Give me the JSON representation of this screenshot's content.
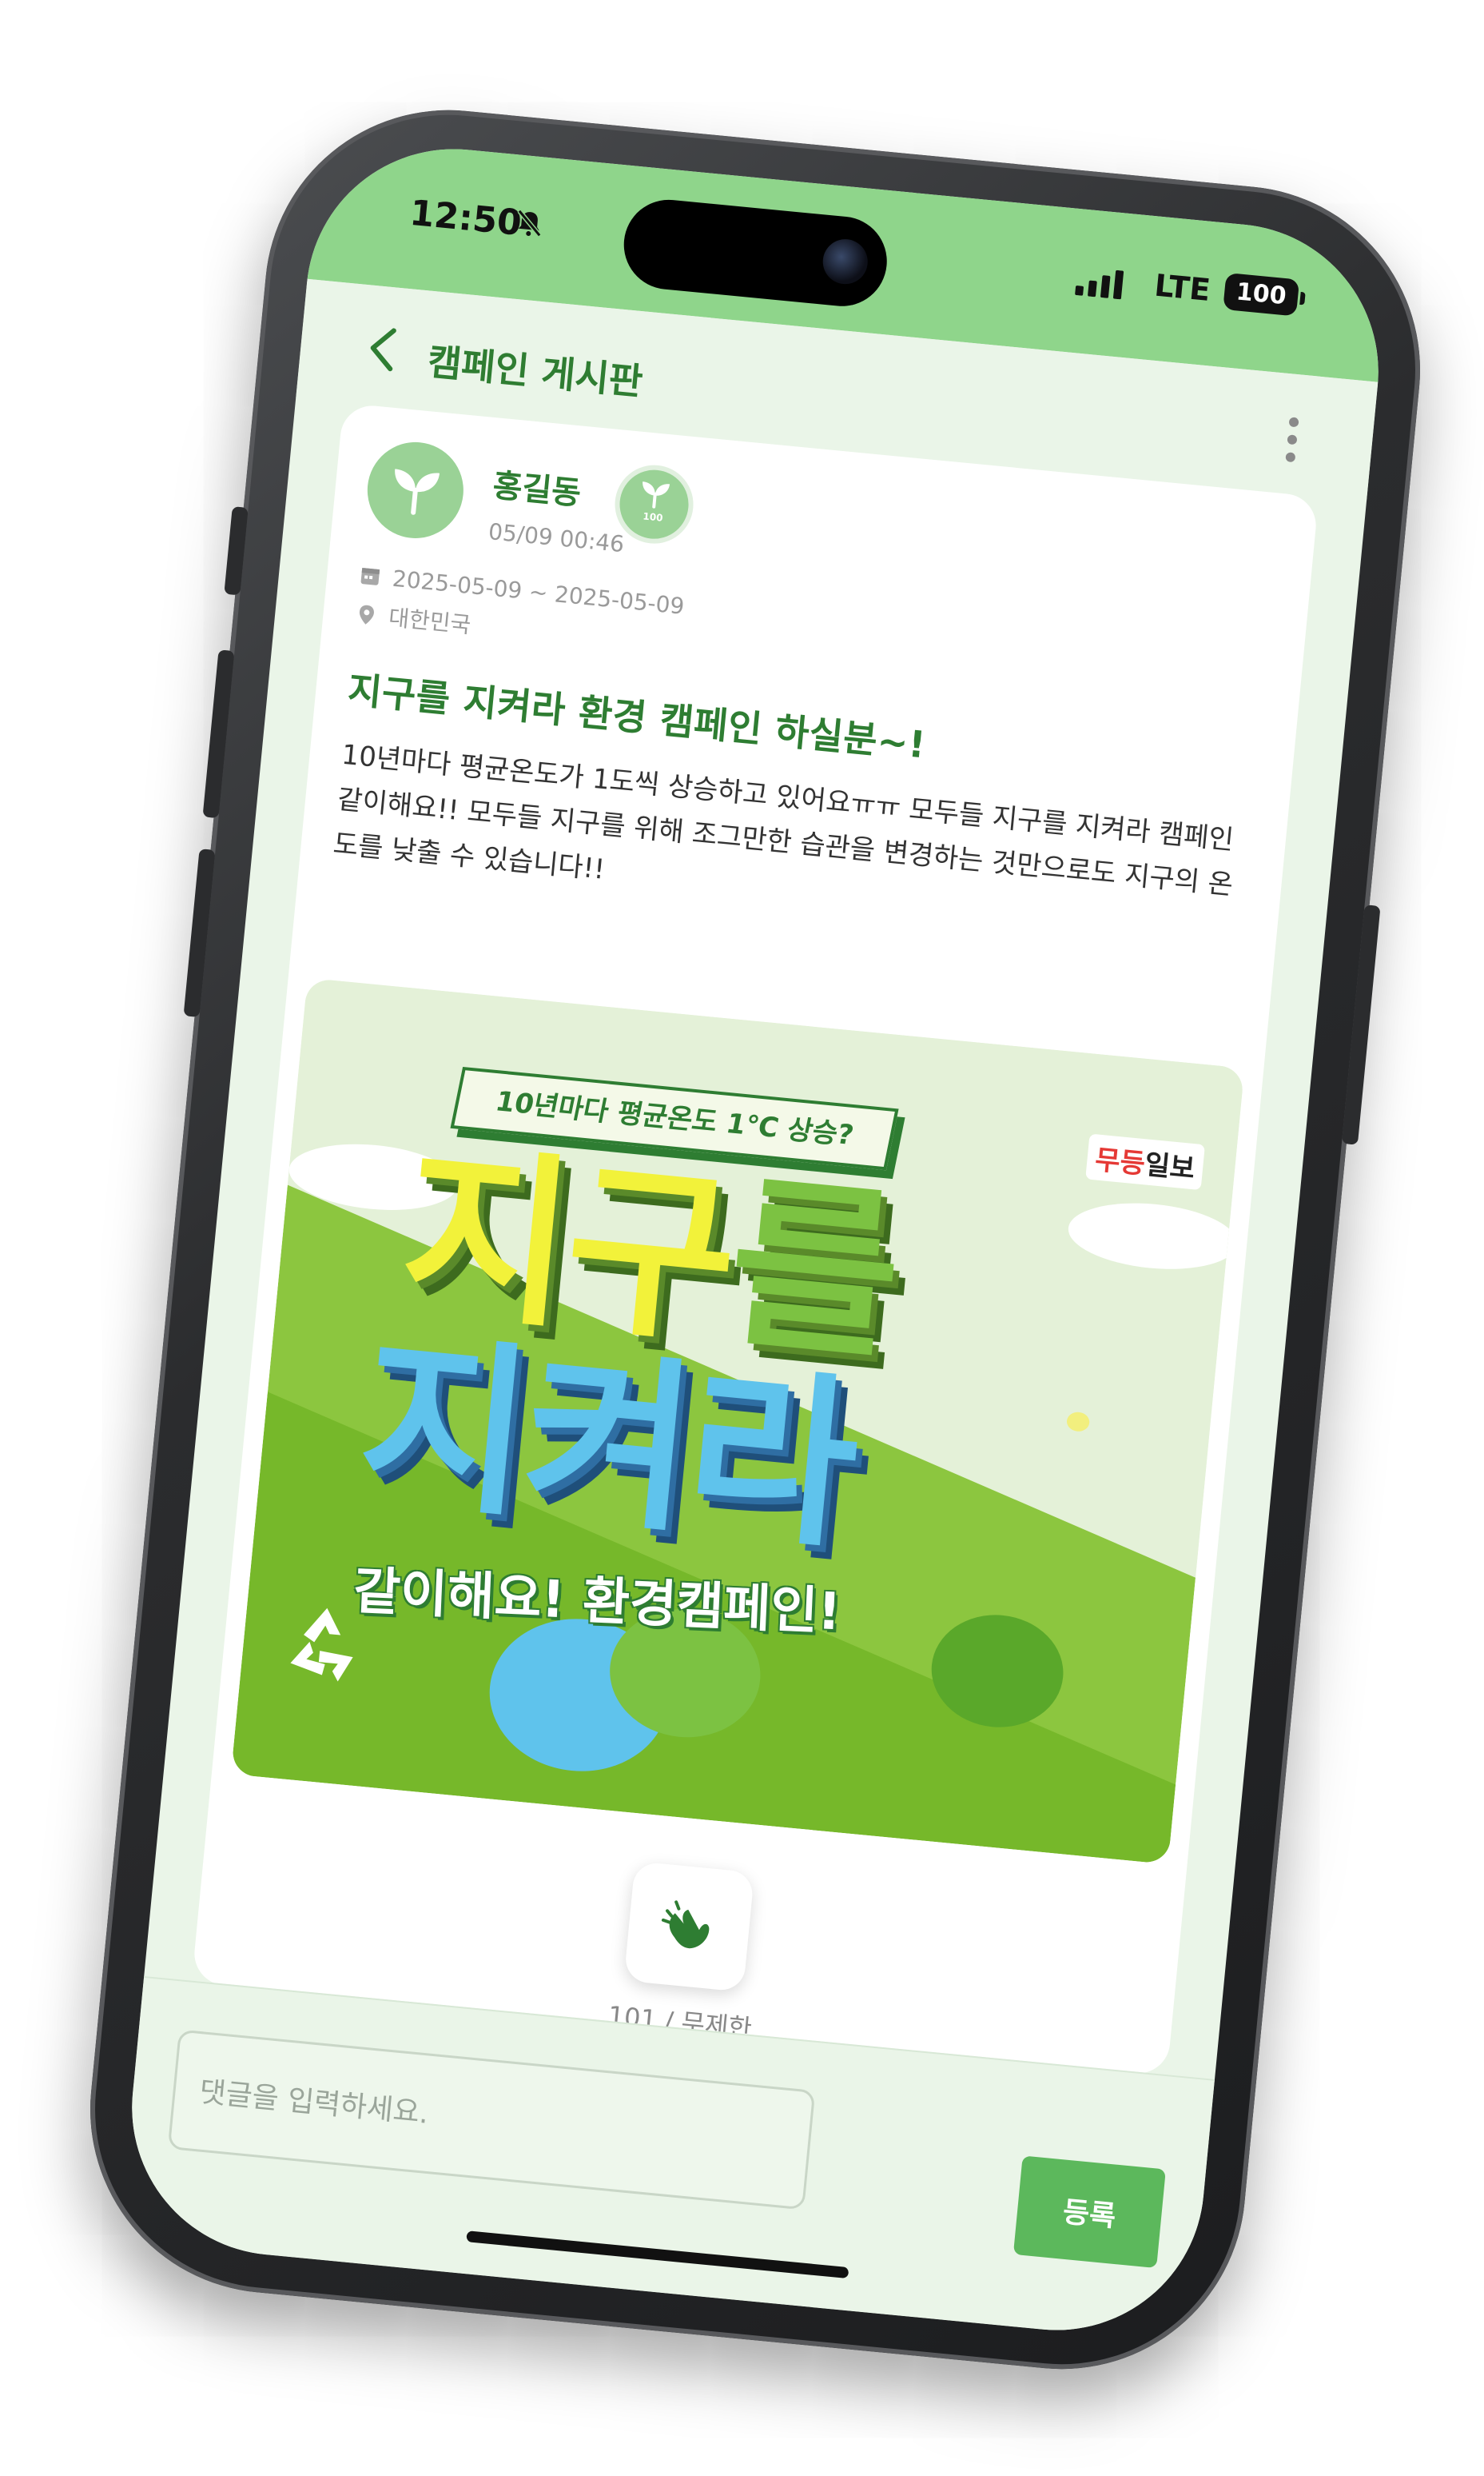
{
  "status_bar": {
    "time": "12:50",
    "network": "LTE",
    "battery": "100"
  },
  "header": {
    "title": "캠페인 게시판"
  },
  "post": {
    "author": "홍길동",
    "badge_label": "100",
    "posted_at": "05/09 00:46",
    "date_range": "2025-05-09 ~ 2025-05-09",
    "location": "대한민국",
    "title": "지구를 지켜라 환경 캠페인 하실분~!",
    "body": "10년마다 평균온도가 1도씩 상승하고 있어요ㅠㅠ 모두들 지구를 지켜라 캠페인 같이해요!! 모두들 지구를 위해 조그만한 습관을 변경하는 것만으로도 지구의 온도를 낮출 수 있습니다!!"
  },
  "poster": {
    "subtitle": "10년마다 평균온도 1℃ 상승?",
    "logo_mark": "무등",
    "logo_text": "일보",
    "headline_1_a": "지구",
    "headline_1_b": "를",
    "headline_2": "지켜라",
    "slogan": "같이해요! 환경캠페인!"
  },
  "like": {
    "count_label": "101 / 무제한"
  },
  "comment": {
    "placeholder": "댓글을 입력하세요.",
    "submit_label": "등록"
  },
  "colors": {
    "accent": "#2e7d32",
    "status_bar": "#8fd58b",
    "button": "#5cb85c",
    "background": "#eaf5e8"
  },
  "icons": [
    "bell-slash-icon",
    "signal-icon",
    "back-arrow-icon",
    "more-vertical-icon",
    "sprout-icon",
    "calendar-icon",
    "location-pin-icon",
    "clap-hands-icon"
  ]
}
